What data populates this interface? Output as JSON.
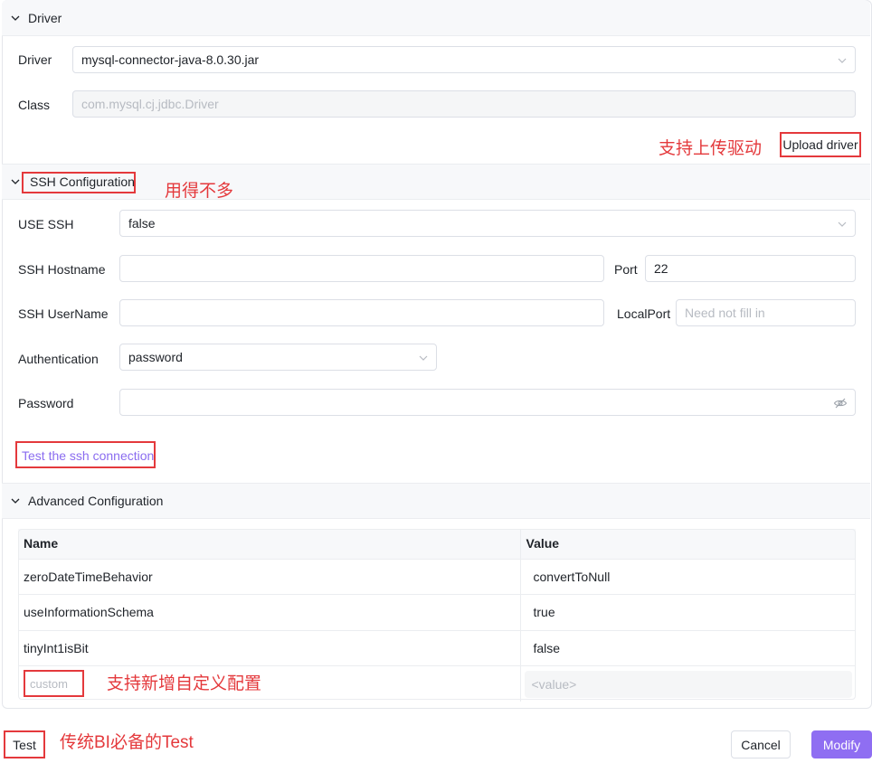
{
  "driver_section": {
    "title": "Driver",
    "driver_label": "Driver",
    "driver_value": "mysql-connector-java-8.0.30.jar",
    "class_label": "Class",
    "class_value": "com.mysql.cj.jdbc.Driver",
    "upload_label": "Upload driver",
    "upload_note": "支持上传驱动"
  },
  "ssh_section": {
    "title": "SSH Configuration",
    "title_note": "用得不多",
    "use_ssh_label": "USE SSH",
    "use_ssh_value": "false",
    "hostname_label": "SSH Hostname",
    "hostname_value": "",
    "port_label": "Port",
    "port_value": "22",
    "username_label": "SSH UserName",
    "username_value": "",
    "localport_label": "LocalPort",
    "localport_placeholder": "Need not fill in",
    "auth_label": "Authentication",
    "auth_value": "password",
    "password_label": "Password",
    "password_value": "",
    "test_link": "Test the ssh connection"
  },
  "advanced_section": {
    "title": "Advanced Configuration",
    "columns": [
      "Name",
      "Value"
    ],
    "rows": [
      {
        "name": "zeroDateTimeBehavior",
        "value": "convertToNull"
      },
      {
        "name": "useInformationSchema",
        "value": "true"
      },
      {
        "name": "tinyInt1isBit",
        "value": "false"
      }
    ],
    "custom_name_placeholder": "custom",
    "custom_value_placeholder": "<value>",
    "custom_note": "支持新增自定义配置"
  },
  "footer": {
    "test_label": "Test",
    "test_note": "传统BI必备的Test",
    "cancel_label": "Cancel",
    "modify_label": "Modify"
  },
  "colors": {
    "accent": "#8f6ef2",
    "annotation_red": "#e4393c",
    "link": "#8a6cf0"
  }
}
